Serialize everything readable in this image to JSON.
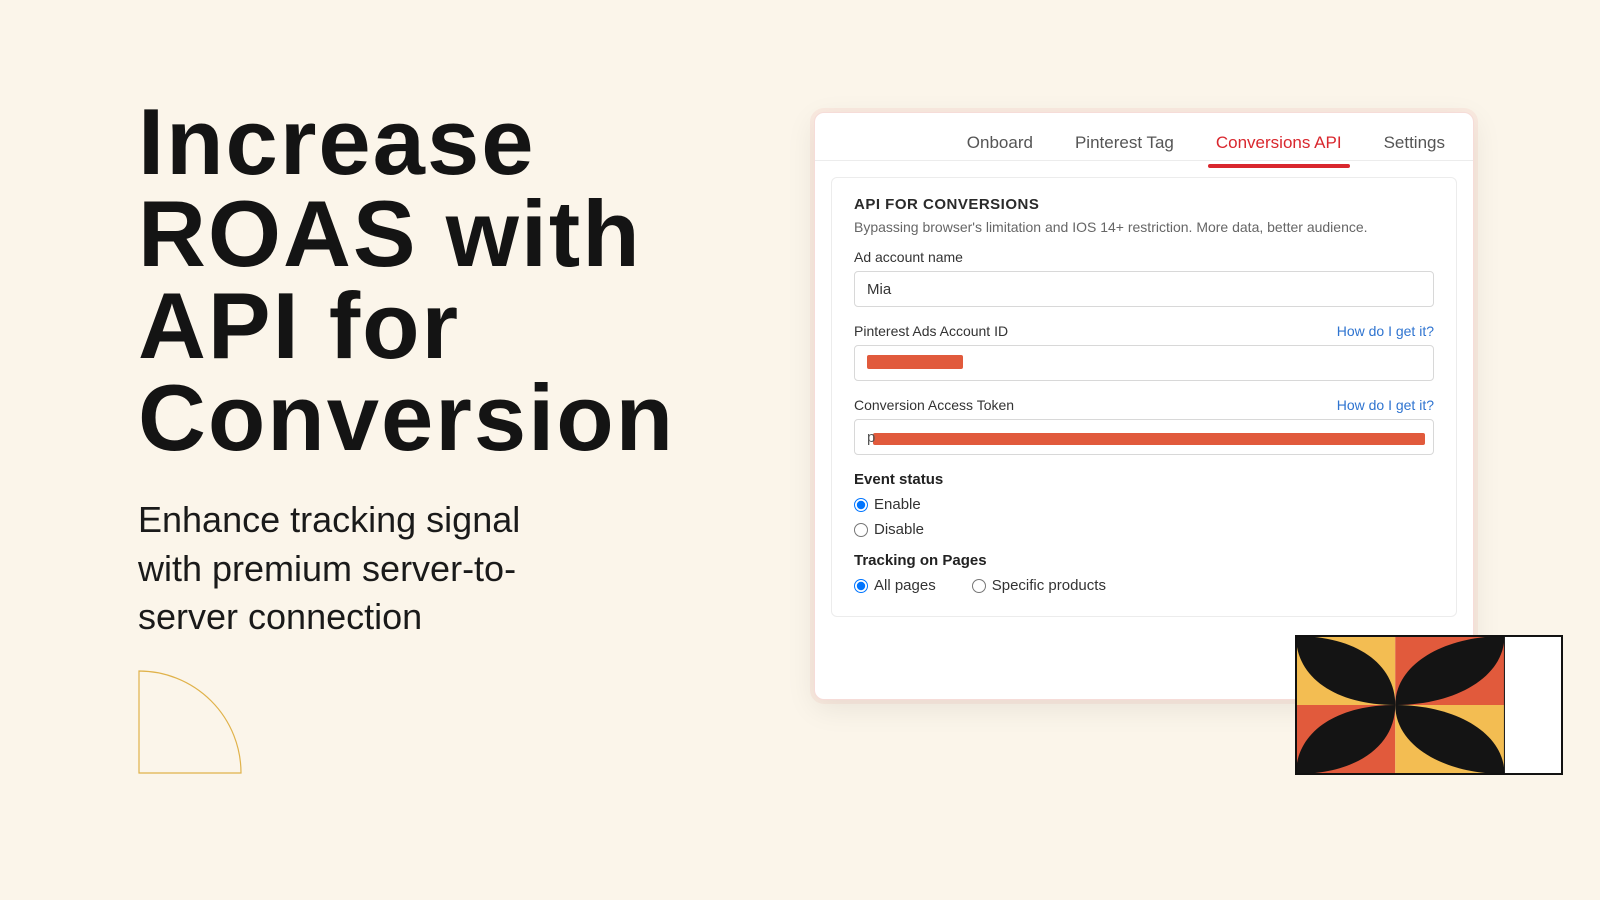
{
  "hero": {
    "title": "Increase ROAS with API for Conversion",
    "subtitle": "Enhance tracking signal with premium server-to-server connection"
  },
  "tabs": [
    {
      "label": "Onboard",
      "active": false
    },
    {
      "label": "Pinterest Tag",
      "active": false
    },
    {
      "label": "Conversions API",
      "active": true
    },
    {
      "label": "Settings",
      "active": false
    }
  ],
  "card": {
    "title": "API FOR CONVERSIONS",
    "subtitle": "Bypassing browser's limitation and IOS 14+ restriction. More data, better audience.",
    "ad_account_label": "Ad account name",
    "ad_account_value": "Mia",
    "ads_id_label": "Pinterest Ads Account ID",
    "ads_id_help": "How do I get it?",
    "token_label": "Conversion Access Token",
    "token_help": "How do I get it?",
    "event_status_label": "Event status",
    "event_enable": "Enable",
    "event_disable": "Disable",
    "tracking_label": "Tracking on Pages",
    "tracking_all": "All pages",
    "tracking_specific": "Specific products"
  }
}
